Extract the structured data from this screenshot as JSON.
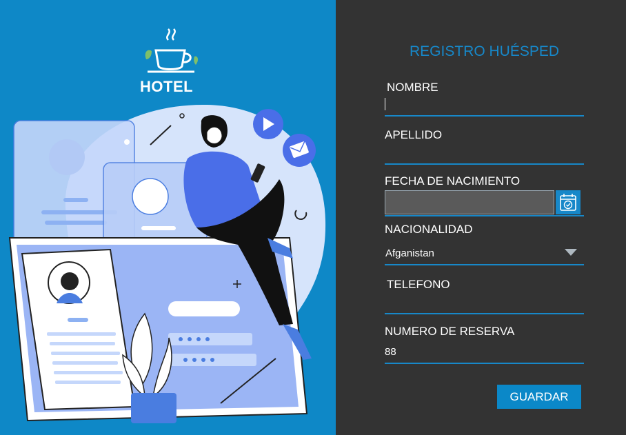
{
  "brand": {
    "logo_text": "HOTEL"
  },
  "form": {
    "title": "REGISTRO HUÉSPED",
    "fields": {
      "nombre": {
        "label": "NOMBRE",
        "value": ""
      },
      "apellido": {
        "label": "APELLIDO",
        "value": ""
      },
      "fecha": {
        "label": "FECHA DE NACIMIENTO",
        "value": ""
      },
      "nacionalidad": {
        "label": "NACIONALIDAD",
        "value": "Afganistan"
      },
      "telefono": {
        "label": "TELEFONO",
        "value": ""
      },
      "reserva": {
        "label": "NUMERO DE RESERVA",
        "value": "88"
      }
    },
    "save_label": "GUARDAR"
  },
  "colors": {
    "left_bg": "#0e88c7",
    "right_bg": "#333333",
    "accent": "#1788c9"
  },
  "icons": [
    "coffee-cup-icon",
    "calendar-icon",
    "chevron-down-icon",
    "play-icon",
    "mail-icon"
  ]
}
